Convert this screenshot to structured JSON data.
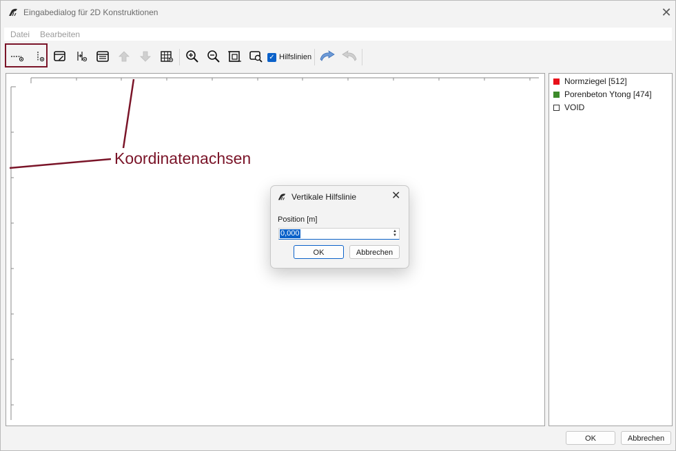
{
  "window": {
    "title": "Eingabedialog für 2D Konstruktionen",
    "close_icon": "close-icon"
  },
  "menu": {
    "items": [
      "Datei",
      "Bearbeiten"
    ]
  },
  "toolbar": {
    "hilfslinien_label": "Hilfslinien",
    "hilfslinien_checked": true,
    "buttons": [
      "horizontal-guide-icon",
      "vertical-guide-icon",
      "table-edit-icon",
      "split-icon",
      "layer-list-icon",
      "arrow-up-icon",
      "arrow-down-icon",
      "grid-icon",
      "zoom-in-icon",
      "zoom-out-icon",
      "zoom-fit-icon",
      "zoom-window-icon",
      "undo-icon",
      "redo-icon"
    ]
  },
  "annotation": {
    "text": "Koordinatenachsen",
    "color": "#7a1428"
  },
  "legend": {
    "items": [
      {
        "label": "Normziegel [512]",
        "color": "#e8101a"
      },
      {
        "label": "Porenbeton Ytong [474]",
        "color": "#3c8a2a"
      },
      {
        "label": "VOID",
        "color": "#ffffff"
      }
    ]
  },
  "dialog": {
    "title": "Vertikale Hilfslinie",
    "field_label": "Position [m]",
    "field_value": "0,000",
    "ok_label": "OK",
    "cancel_label": "Abbrechen"
  },
  "footer": {
    "ok_label": "OK",
    "cancel_label": "Abbrechen"
  }
}
